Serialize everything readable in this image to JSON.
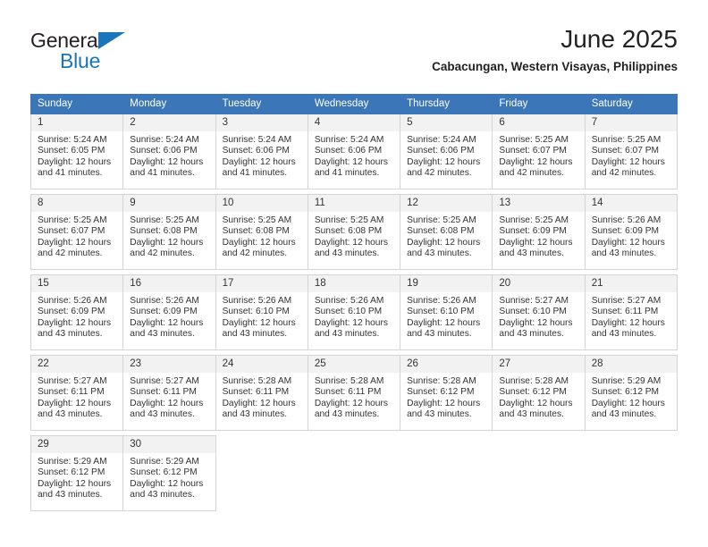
{
  "brand": {
    "name_top": "General",
    "name_bottom": "Blue",
    "triangle_color": "#1b75bb"
  },
  "header": {
    "month_title": "June 2025",
    "location": "Cabacungan, Western Visayas, Philippines"
  },
  "theme": {
    "header_bg": "#3b77b8",
    "daynum_bg": "#f2f2f2",
    "cell_border": "#d4d4d4"
  },
  "calendar": {
    "weekday_headers": [
      "Sunday",
      "Monday",
      "Tuesday",
      "Wednesday",
      "Thursday",
      "Friday",
      "Saturday"
    ],
    "weeks": [
      [
        {
          "day": "1",
          "sunrise": "Sunrise: 5:24 AM",
          "sunset": "Sunset: 6:05 PM",
          "daylight_1": "Daylight: 12 hours",
          "daylight_2": "and 41 minutes."
        },
        {
          "day": "2",
          "sunrise": "Sunrise: 5:24 AM",
          "sunset": "Sunset: 6:06 PM",
          "daylight_1": "Daylight: 12 hours",
          "daylight_2": "and 41 minutes."
        },
        {
          "day": "3",
          "sunrise": "Sunrise: 5:24 AM",
          "sunset": "Sunset: 6:06 PM",
          "daylight_1": "Daylight: 12 hours",
          "daylight_2": "and 41 minutes."
        },
        {
          "day": "4",
          "sunrise": "Sunrise: 5:24 AM",
          "sunset": "Sunset: 6:06 PM",
          "daylight_1": "Daylight: 12 hours",
          "daylight_2": "and 41 minutes."
        },
        {
          "day": "5",
          "sunrise": "Sunrise: 5:24 AM",
          "sunset": "Sunset: 6:06 PM",
          "daylight_1": "Daylight: 12 hours",
          "daylight_2": "and 42 minutes."
        },
        {
          "day": "6",
          "sunrise": "Sunrise: 5:25 AM",
          "sunset": "Sunset: 6:07 PM",
          "daylight_1": "Daylight: 12 hours",
          "daylight_2": "and 42 minutes."
        },
        {
          "day": "7",
          "sunrise": "Sunrise: 5:25 AM",
          "sunset": "Sunset: 6:07 PM",
          "daylight_1": "Daylight: 12 hours",
          "daylight_2": "and 42 minutes."
        }
      ],
      [
        {
          "day": "8",
          "sunrise": "Sunrise: 5:25 AM",
          "sunset": "Sunset: 6:07 PM",
          "daylight_1": "Daylight: 12 hours",
          "daylight_2": "and 42 minutes."
        },
        {
          "day": "9",
          "sunrise": "Sunrise: 5:25 AM",
          "sunset": "Sunset: 6:08 PM",
          "daylight_1": "Daylight: 12 hours",
          "daylight_2": "and 42 minutes."
        },
        {
          "day": "10",
          "sunrise": "Sunrise: 5:25 AM",
          "sunset": "Sunset: 6:08 PM",
          "daylight_1": "Daylight: 12 hours",
          "daylight_2": "and 42 minutes."
        },
        {
          "day": "11",
          "sunrise": "Sunrise: 5:25 AM",
          "sunset": "Sunset: 6:08 PM",
          "daylight_1": "Daylight: 12 hours",
          "daylight_2": "and 43 minutes."
        },
        {
          "day": "12",
          "sunrise": "Sunrise: 5:25 AM",
          "sunset": "Sunset: 6:08 PM",
          "daylight_1": "Daylight: 12 hours",
          "daylight_2": "and 43 minutes."
        },
        {
          "day": "13",
          "sunrise": "Sunrise: 5:25 AM",
          "sunset": "Sunset: 6:09 PM",
          "daylight_1": "Daylight: 12 hours",
          "daylight_2": "and 43 minutes."
        },
        {
          "day": "14",
          "sunrise": "Sunrise: 5:26 AM",
          "sunset": "Sunset: 6:09 PM",
          "daylight_1": "Daylight: 12 hours",
          "daylight_2": "and 43 minutes."
        }
      ],
      [
        {
          "day": "15",
          "sunrise": "Sunrise: 5:26 AM",
          "sunset": "Sunset: 6:09 PM",
          "daylight_1": "Daylight: 12 hours",
          "daylight_2": "and 43 minutes."
        },
        {
          "day": "16",
          "sunrise": "Sunrise: 5:26 AM",
          "sunset": "Sunset: 6:09 PM",
          "daylight_1": "Daylight: 12 hours",
          "daylight_2": "and 43 minutes."
        },
        {
          "day": "17",
          "sunrise": "Sunrise: 5:26 AM",
          "sunset": "Sunset: 6:10 PM",
          "daylight_1": "Daylight: 12 hours",
          "daylight_2": "and 43 minutes."
        },
        {
          "day": "18",
          "sunrise": "Sunrise: 5:26 AM",
          "sunset": "Sunset: 6:10 PM",
          "daylight_1": "Daylight: 12 hours",
          "daylight_2": "and 43 minutes."
        },
        {
          "day": "19",
          "sunrise": "Sunrise: 5:26 AM",
          "sunset": "Sunset: 6:10 PM",
          "daylight_1": "Daylight: 12 hours",
          "daylight_2": "and 43 minutes."
        },
        {
          "day": "20",
          "sunrise": "Sunrise: 5:27 AM",
          "sunset": "Sunset: 6:10 PM",
          "daylight_1": "Daylight: 12 hours",
          "daylight_2": "and 43 minutes."
        },
        {
          "day": "21",
          "sunrise": "Sunrise: 5:27 AM",
          "sunset": "Sunset: 6:11 PM",
          "daylight_1": "Daylight: 12 hours",
          "daylight_2": "and 43 minutes."
        }
      ],
      [
        {
          "day": "22",
          "sunrise": "Sunrise: 5:27 AM",
          "sunset": "Sunset: 6:11 PM",
          "daylight_1": "Daylight: 12 hours",
          "daylight_2": "and 43 minutes."
        },
        {
          "day": "23",
          "sunrise": "Sunrise: 5:27 AM",
          "sunset": "Sunset: 6:11 PM",
          "daylight_1": "Daylight: 12 hours",
          "daylight_2": "and 43 minutes."
        },
        {
          "day": "24",
          "sunrise": "Sunrise: 5:28 AM",
          "sunset": "Sunset: 6:11 PM",
          "daylight_1": "Daylight: 12 hours",
          "daylight_2": "and 43 minutes."
        },
        {
          "day": "25",
          "sunrise": "Sunrise: 5:28 AM",
          "sunset": "Sunset: 6:11 PM",
          "daylight_1": "Daylight: 12 hours",
          "daylight_2": "and 43 minutes."
        },
        {
          "day": "26",
          "sunrise": "Sunrise: 5:28 AM",
          "sunset": "Sunset: 6:12 PM",
          "daylight_1": "Daylight: 12 hours",
          "daylight_2": "and 43 minutes."
        },
        {
          "day": "27",
          "sunrise": "Sunrise: 5:28 AM",
          "sunset": "Sunset: 6:12 PM",
          "daylight_1": "Daylight: 12 hours",
          "daylight_2": "and 43 minutes."
        },
        {
          "day": "28",
          "sunrise": "Sunrise: 5:29 AM",
          "sunset": "Sunset: 6:12 PM",
          "daylight_1": "Daylight: 12 hours",
          "daylight_2": "and 43 minutes."
        }
      ],
      [
        {
          "day": "29",
          "sunrise": "Sunrise: 5:29 AM",
          "sunset": "Sunset: 6:12 PM",
          "daylight_1": "Daylight: 12 hours",
          "daylight_2": "and 43 minutes."
        },
        {
          "day": "30",
          "sunrise": "Sunrise: 5:29 AM",
          "sunset": "Sunset: 6:12 PM",
          "daylight_1": "Daylight: 12 hours",
          "daylight_2": "and 43 minutes."
        },
        null,
        null,
        null,
        null,
        null
      ]
    ]
  }
}
